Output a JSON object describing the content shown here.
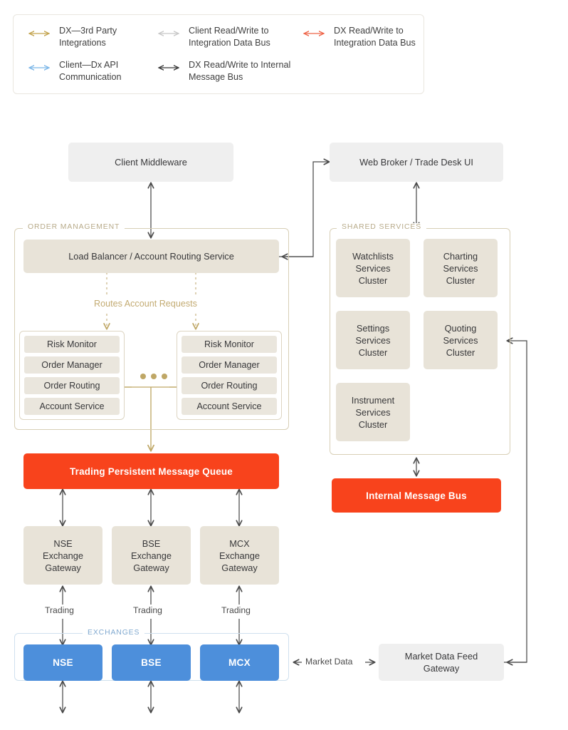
{
  "legend": {
    "items": [
      {
        "label": "DX—3rd Party\nIntegrations",
        "color": "#c3a44f",
        "col": 0,
        "row": 0
      },
      {
        "label": "Client—Dx API\nCommunication",
        "color": "#7cb6e8",
        "col": 0,
        "row": 1
      },
      {
        "label": "Client Read/Write to\nIntegration Data Bus",
        "color": "#c8c8c8",
        "col": 1,
        "row": 0
      },
      {
        "label": "DX Read/Write to\nInternal Message Bus",
        "color": "#3b3b3b",
        "col": 1,
        "row": 1
      },
      {
        "label": "DX Read/Write to\nIntegration Data Bus",
        "color": "#ee6347",
        "col": 2,
        "row": 0
      }
    ]
  },
  "nodes": {
    "client_middleware": "Client Middleware",
    "web_broker": "Web Broker / Trade Desk UI",
    "load_balancer": "Load Balancer / Account Routing Service",
    "trading_queue": "Trading Persistent Message Queue",
    "internal_bus": "Internal Message Bus",
    "market_data_gateway": "Market Data Feed\nGateway"
  },
  "groups": {
    "order_management": "ORDER MANAGEMENT",
    "shared_services": "SHARED SERVICES",
    "exchanges": "EXCHANGES"
  },
  "order_management": {
    "routing_label": "Routes Account Requests",
    "clusters": [
      {
        "items": [
          "Risk Monitor",
          "Order Manager",
          "Order Routing",
          "Account Service"
        ]
      },
      {
        "items": [
          "Risk Monitor",
          "Order Manager",
          "Order Routing",
          "Account Service"
        ]
      }
    ]
  },
  "shared_services": {
    "clusters": [
      "Watchlists\nServices\nCluster",
      "Charting\nServices\nCluster",
      "Settings\nServices\nCluster",
      "Quoting\nServices\nCluster",
      "Instrument\nServices\nCluster"
    ]
  },
  "gateways": [
    "NSE\nExchange\nGateway",
    "BSE\nExchange\nGateway",
    "MCX\nExchange\nGateway"
  ],
  "exchanges": [
    "NSE",
    "BSE",
    "MCX"
  ],
  "edge_labels": {
    "trading": [
      "Trading",
      "Trading",
      "Trading"
    ],
    "market_data": "Market Data"
  },
  "colors": {
    "red": "#f8431c",
    "blue": "#4d8fdb",
    "beige": "#e8e3d8",
    "gray": "#efefef",
    "gold": "#c3ab72",
    "dark_arrow": "#4a4a4a"
  }
}
